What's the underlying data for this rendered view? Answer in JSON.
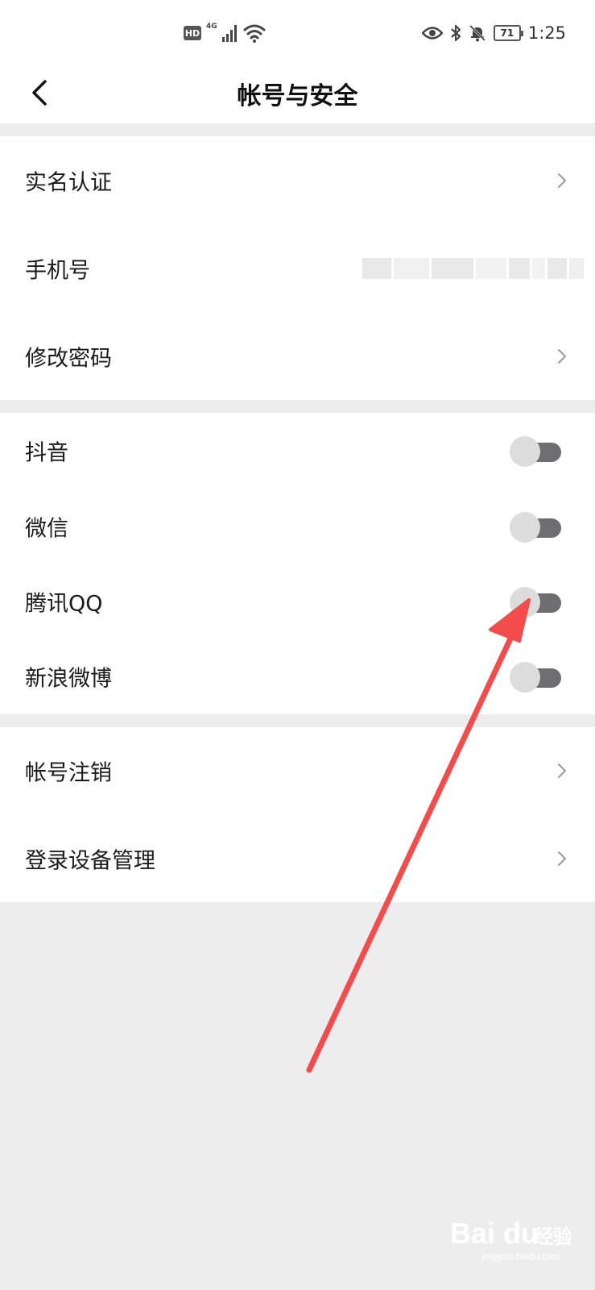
{
  "status_bar": {
    "hd": "HD",
    "network": "4G",
    "battery": "71",
    "time": "1:25"
  },
  "nav": {
    "title": "帐号与安全"
  },
  "groups": [
    {
      "items": [
        {
          "label": "实名认证",
          "type": "chevron"
        },
        {
          "label": "手机号",
          "type": "value"
        },
        {
          "label": "修改密码",
          "type": "chevron"
        }
      ]
    },
    {
      "items": [
        {
          "label": "抖音",
          "type": "toggle",
          "on": false
        },
        {
          "label": "微信",
          "type": "toggle",
          "on": false
        },
        {
          "label": "腾讯QQ",
          "type": "toggle",
          "on": false
        },
        {
          "label": "新浪微博",
          "type": "toggle",
          "on": false
        }
      ]
    },
    {
      "items": [
        {
          "label": "帐号注销",
          "type": "chevron"
        },
        {
          "label": "登录设备管理",
          "type": "chevron"
        }
      ]
    }
  ],
  "watermark": {
    "brand": "Bai du",
    "suffix": "经验",
    "url": "jingyan.baidu.com"
  },
  "colors": {
    "page_bg": "#ededed",
    "toggle_track": "#6e6e70",
    "toggle_knob": "#dcdcdc",
    "annotation_arrow": "#f44b4b"
  }
}
